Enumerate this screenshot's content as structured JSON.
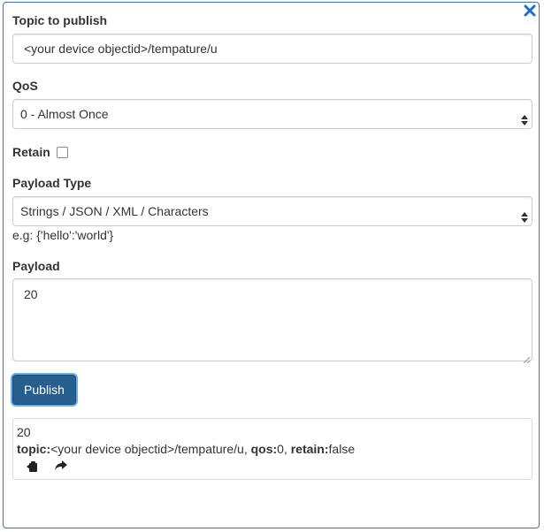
{
  "form": {
    "topic_label": "Topic to publish",
    "topic_value": "<your device objectid>/tempature/u",
    "qos_label": "QoS",
    "qos_selected": "0 - Almost Once",
    "retain_label": "Retain",
    "retain_checked": false,
    "payload_type_label": "Payload Type",
    "payload_type_selected": "Strings / JSON / XML / Characters",
    "payload_hint": "e.g: {'hello':'world'}",
    "payload_label": "Payload",
    "payload_value": "20",
    "publish_label": "Publish"
  },
  "result": {
    "payload": "20",
    "topic_key": "topic:",
    "topic_value": "<your device objectid>/tempature/u",
    "qos_key": "qos:",
    "qos_value": "0",
    "retain_key": "retain:",
    "retain_value": "false"
  },
  "icons": {
    "close": "close-icon",
    "republish": "republish-icon",
    "forward": "share-arrow-icon"
  },
  "colors": {
    "accent": "#285e8e",
    "close_icon": "#1f6fd1"
  }
}
